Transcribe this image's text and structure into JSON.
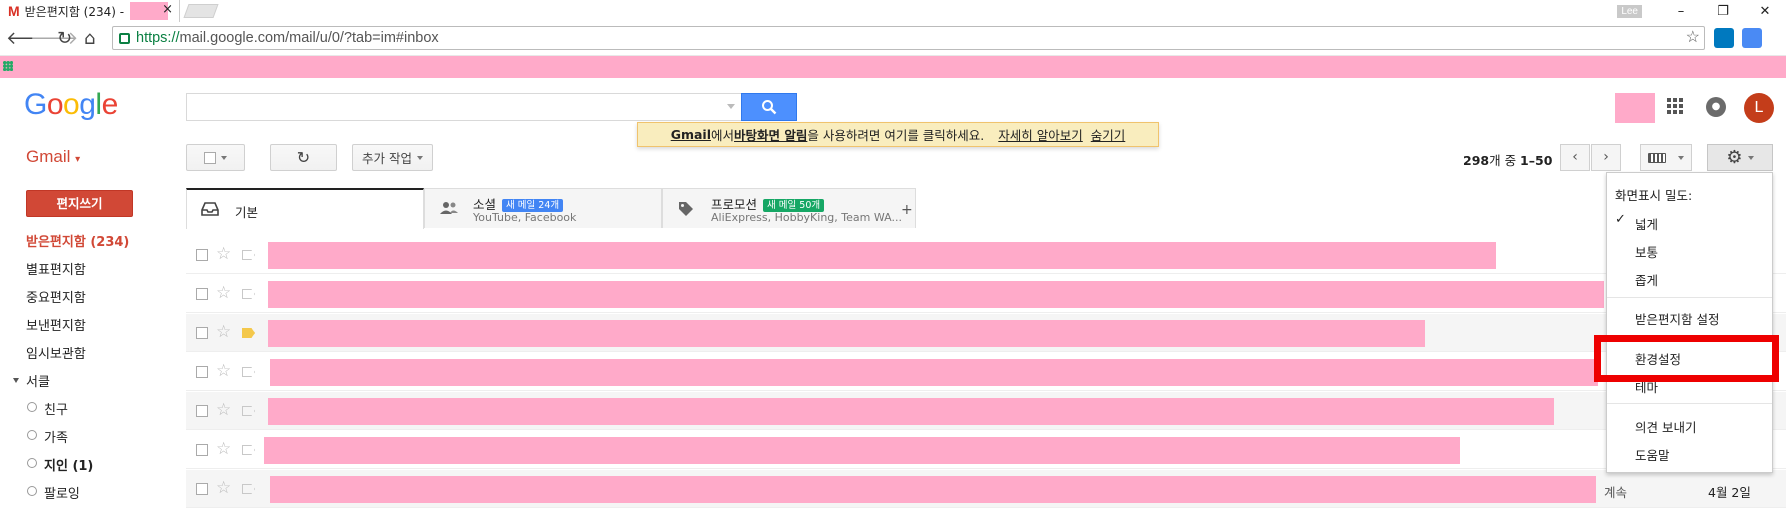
{
  "browser": {
    "tab_title": "받은편지함 (234) -",
    "tab_close": "×",
    "user_badge": "Lee",
    "win_min": "–",
    "win_max": "❐",
    "win_close": "✕",
    "url_scheme": "https://",
    "url_rest": "mail.google.com/mail/u/0/?tab=im#inbox"
  },
  "header": {
    "logo_letters": [
      "G",
      "o",
      "o",
      "g",
      "l",
      "e"
    ],
    "search_value": "",
    "avatar_letter": "L"
  },
  "toolbar": {
    "gmail_label": "Gmail",
    "more_label": "추가 작업",
    "pagination_prefix": "298",
    "pagination_mid": "개 중 ",
    "pagination_range": "1–50"
  },
  "notice": {
    "gmail": "Gmail",
    "text_a": "에서 ",
    "desktop_alert": "바탕화면 알림",
    "text_b": "을 사용하려면 여기를 클릭하세요.",
    "learn_more": "자세히 알아보기",
    "hide": "숨기기"
  },
  "sidebar": {
    "compose": "편지쓰기",
    "items": [
      {
        "label": "받은편지함 (234)",
        "active": true
      },
      {
        "label": "별표편지함"
      },
      {
        "label": "중요편지함"
      },
      {
        "label": "보낸편지함"
      },
      {
        "label": "임시보관함"
      },
      {
        "label": "서클"
      }
    ],
    "circles": [
      {
        "label": "친구"
      },
      {
        "label": "가족"
      },
      {
        "label": "지인 (1)"
      },
      {
        "label": "팔로잉"
      }
    ]
  },
  "tabs": {
    "primary": {
      "label": "기본"
    },
    "social": {
      "label": "소셜",
      "badge": "새 메일 24개",
      "sub": "YouTube, Facebook"
    },
    "promotions": {
      "label": "프로모션",
      "badge": "새 메일 50개",
      "sub": "AliExpress, HobbyKing, Team WA..."
    },
    "add": "+"
  },
  "emails": {
    "row7_tail": "계속",
    "row7_date": "4월 2일"
  },
  "settings_menu": {
    "density_header": "화면표시 밀도:",
    "check": "✓",
    "comfortable": "넓게",
    "cozy": "보통",
    "compact": "좁게",
    "inbox_settings": "받은편지함 설정",
    "settings": "환경설정",
    "themes": "테마",
    "feedback": "의견 보내기",
    "help": "도움말"
  },
  "colors": {
    "redaction": "#ffaac9",
    "gmail_red": "#d14836",
    "search_blue": "#4d90fe",
    "highlight": "#ee0000",
    "social_badge": "#4285f4",
    "promo_badge": "#16a765"
  },
  "icons": {
    "back": "back-arrow-icon",
    "forward": "forward-arrow-icon",
    "reload": "reload-icon",
    "home": "home-icon",
    "search": "search-icon",
    "apps": "apps-grid-icon",
    "notifications": "bell-icon",
    "settings": "gear-icon"
  }
}
